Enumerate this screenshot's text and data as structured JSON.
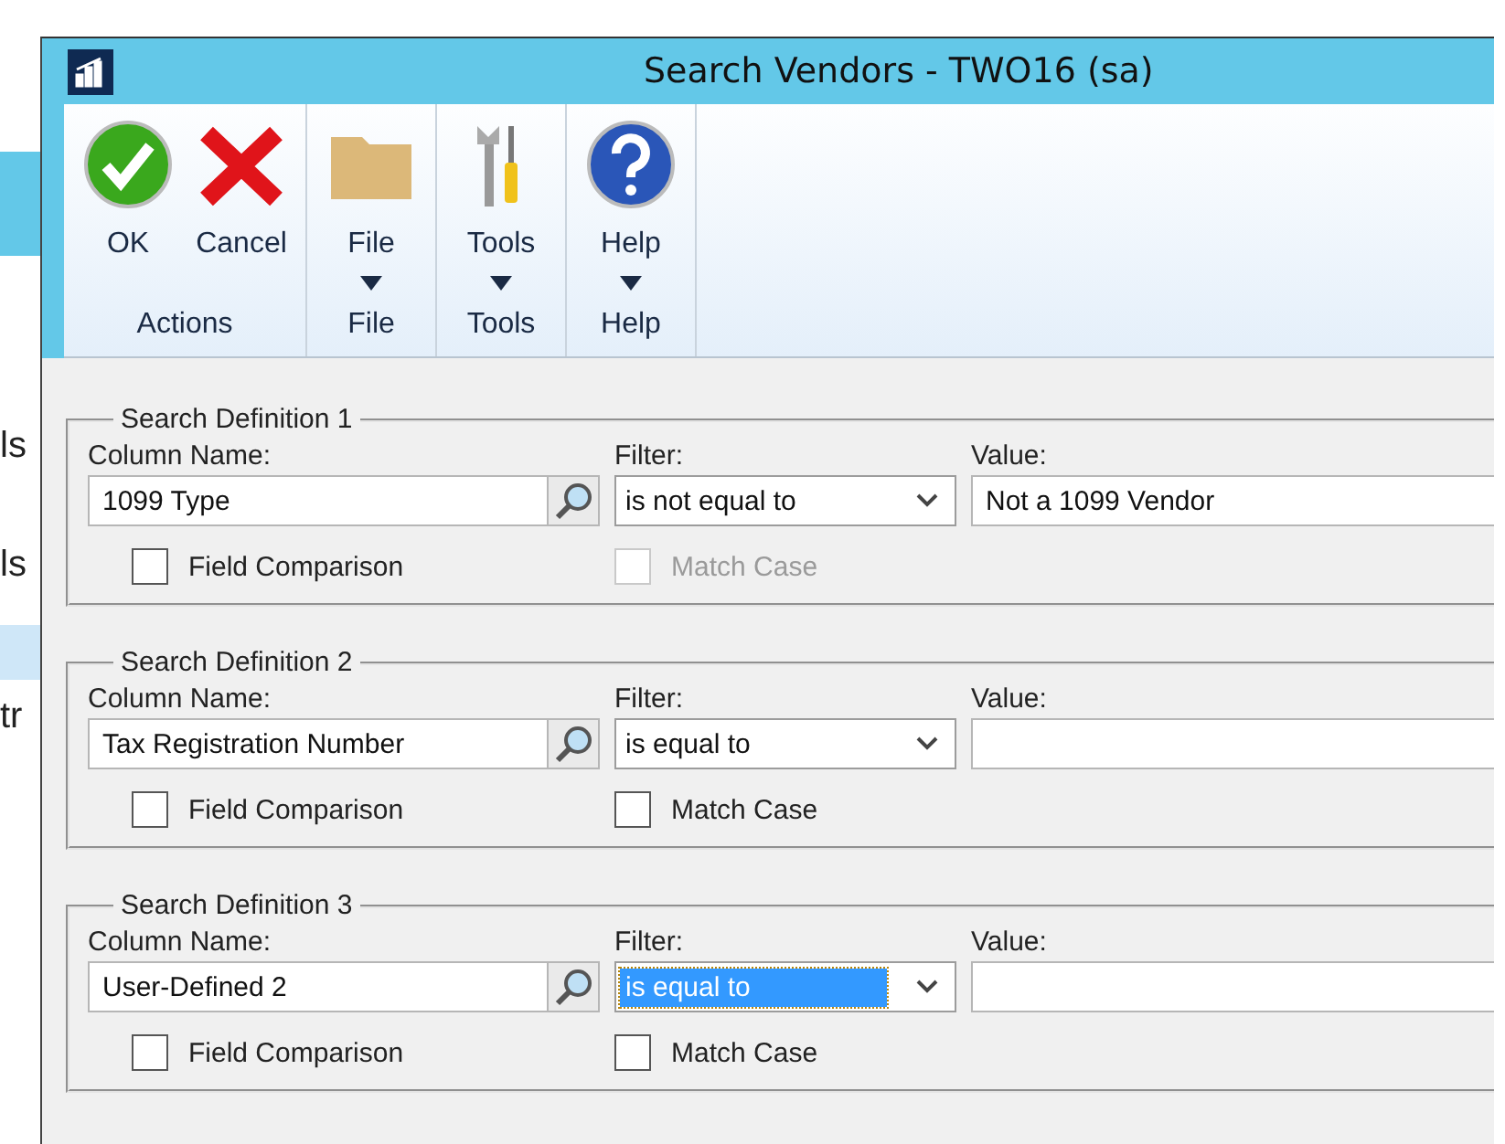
{
  "background_window": {
    "texts": [
      "ls",
      "ls",
      "tr"
    ]
  },
  "window": {
    "title": "Search Vendors  -  TWO16 (sa)"
  },
  "ribbon": {
    "groups": [
      {
        "label": "Actions",
        "buttons": [
          {
            "kind": "ok",
            "label": "OK",
            "dropdown": false
          },
          {
            "kind": "cancel",
            "label": "Cancel",
            "dropdown": false
          }
        ]
      },
      {
        "label": "File",
        "buttons": [
          {
            "kind": "file",
            "label": "File",
            "dropdown": true
          }
        ]
      },
      {
        "label": "Tools",
        "buttons": [
          {
            "kind": "tools",
            "label": "Tools",
            "dropdown": true
          }
        ]
      },
      {
        "label": "Help",
        "buttons": [
          {
            "kind": "help",
            "label": "Help",
            "dropdown": true
          }
        ]
      }
    ]
  },
  "search_definitions": [
    {
      "title": "Search Definition 1",
      "column_name_label": "Column Name:",
      "column_name": "1099 Type",
      "filter_label": "Filter:",
      "filter": "is not equal to",
      "filter_selected": false,
      "value_label": "Value:",
      "value": "Not a 1099 Vendor",
      "field_comparison": {
        "label": "Field Comparison",
        "checked": false
      },
      "match_case": {
        "label": "Match Case",
        "checked": false,
        "disabled": true
      }
    },
    {
      "title": "Search Definition 2",
      "column_name_label": "Column Name:",
      "column_name": "Tax Registration Number",
      "filter_label": "Filter:",
      "filter": "is equal to",
      "filter_selected": false,
      "value_label": "Value:",
      "field_comparison": {
        "label": "Field Comparison",
        "checked": false
      },
      "match_case": {
        "label": "Match Case",
        "checked": false,
        "disabled": false
      }
    },
    {
      "title": "Search Definition 3",
      "column_name_label": "Column Name:",
      "column_name": "User-Defined 2",
      "filter_label": "Filter:",
      "filter": "is equal to",
      "filter_selected": true,
      "value_label": "Value:",
      "field_comparison": {
        "label": "Field Comparison",
        "checked": false
      },
      "match_case": {
        "label": "Match Case",
        "checked": false,
        "disabled": false
      }
    }
  ]
}
